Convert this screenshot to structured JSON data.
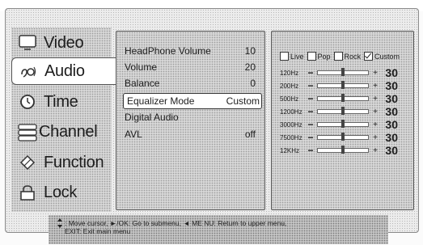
{
  "sidebar": {
    "items": [
      {
        "label": "Video",
        "icon": "monitor-icon",
        "selected": false
      },
      {
        "label": "Audio",
        "icon": "audio-icon",
        "selected": true
      },
      {
        "label": "Time",
        "icon": "clock-icon",
        "selected": false
      },
      {
        "label": "Channel",
        "icon": "channel-icon",
        "selected": false
      },
      {
        "label": "Function",
        "icon": "function-icon",
        "selected": false
      },
      {
        "label": "Lock",
        "icon": "lock-icon",
        "selected": false
      }
    ]
  },
  "audio_menu": {
    "items": [
      {
        "label": "HeadPhone Volume",
        "value": "10"
      },
      {
        "label": "Volume",
        "value": "20"
      },
      {
        "label": "Balance",
        "value": "0"
      },
      {
        "label": "Equalizer Mode",
        "value": "Custom",
        "highlighted": true
      },
      {
        "label": "Digital Audio",
        "value": ""
      },
      {
        "label": "AVL",
        "value": "off"
      }
    ]
  },
  "equalizer": {
    "presets": [
      {
        "label": "Live",
        "checked": false
      },
      {
        "label": "Pop",
        "checked": false
      },
      {
        "label": "Rock",
        "checked": false
      },
      {
        "label": "Custom",
        "checked": true
      }
    ],
    "bands": [
      {
        "label": "120Hz",
        "value": "30"
      },
      {
        "label": "200Hz",
        "value": "30"
      },
      {
        "label": "500Hz",
        "value": "30"
      },
      {
        "label": "1200Hz",
        "value": "30"
      },
      {
        "label": "3000Hz",
        "value": "30"
      },
      {
        "label": "7500Hz",
        "value": "30"
      },
      {
        "label": "12KHz",
        "value": "30"
      }
    ],
    "minus_symbol": "−",
    "plus_symbol": "+"
  },
  "help": {
    "line1": ": Move cursor,  ►/OK: Go to submenu,  ◄ ME NU: Return to upper menu,",
    "line2": "EXIT: Exit main menu"
  }
}
